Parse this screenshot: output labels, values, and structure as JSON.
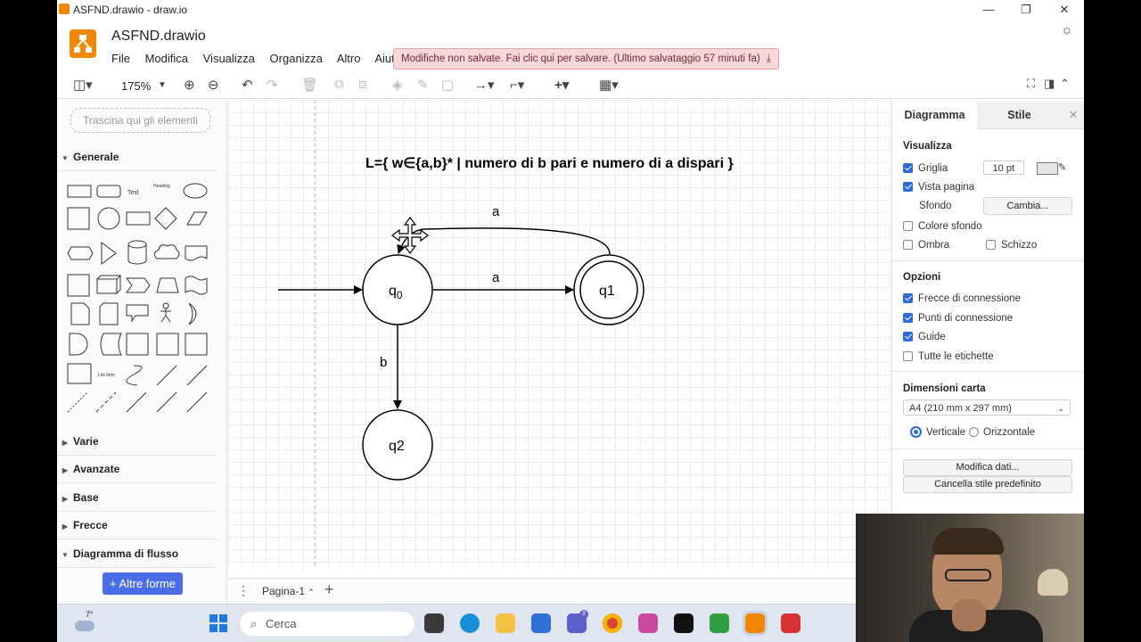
{
  "window": {
    "title": "ASFND.drawio - draw.io",
    "minimize": "—",
    "maximize": "❐",
    "close": "✕"
  },
  "header": {
    "doc_title": "ASFND.drawio",
    "menu": [
      "File",
      "Modifica",
      "Visualizza",
      "Organizza",
      "Altro",
      "Aiuto"
    ],
    "unsaved_notice": "Modifiche non salvate. Fai clic qui per salvare. (Ultimo salvataggio 57 minuti fa)"
  },
  "toolbar": {
    "zoom": "175%"
  },
  "left_panel": {
    "drop_hint": "Trascina qui gli elementi",
    "sections": [
      "Generale",
      "Varie",
      "Avanzate",
      "Base",
      "Frecce",
      "Diagramma di flusso"
    ],
    "shape_text_label": "Text",
    "shape_heading_label": "Heading",
    "shape_listitem_label": "List Item",
    "more_shapes": "+ Altre forme"
  },
  "diagram": {
    "title": "L={ w∈{a,b}* | numero di b pari e numero di a dispari }",
    "states": [
      {
        "label": "q",
        "sub": "0"
      },
      {
        "label": "q1"
      },
      {
        "label": "q2"
      }
    ],
    "edges": [
      "a",
      "a",
      "b"
    ]
  },
  "bottom_bar": {
    "page_tab": "Pagina-1"
  },
  "right_panel": {
    "tabs": [
      "Diagramma",
      "Stile"
    ],
    "visualizza": "Visualizza",
    "griglia": "Griglia",
    "grid_size": "10 pt",
    "vista_pagina": "Vista pagina",
    "sfondo": "Sfondo",
    "cambia": "Cambia...",
    "colore_sfondo": "Colore sfondo",
    "ombra": "Ombra",
    "schizzo": "Schizzo",
    "opzioni": "Opzioni",
    "frecce": "Frecce di connessione",
    "punti": "Punti di connessione",
    "guide": "Guide",
    "tutte_etichette": "Tutte le etichette",
    "dimensioni": "Dimensioni carta",
    "paper": "A4 (210 mm x 297 mm)",
    "verticale": "Verticale",
    "orizzontale": "Orizzontale",
    "modifica_dati": "Modifica dati...",
    "cancella_stile": "Cancella stile predefinito"
  },
  "taskbar": {
    "weather": "7°",
    "search": "Cerca",
    "badge": "3"
  }
}
